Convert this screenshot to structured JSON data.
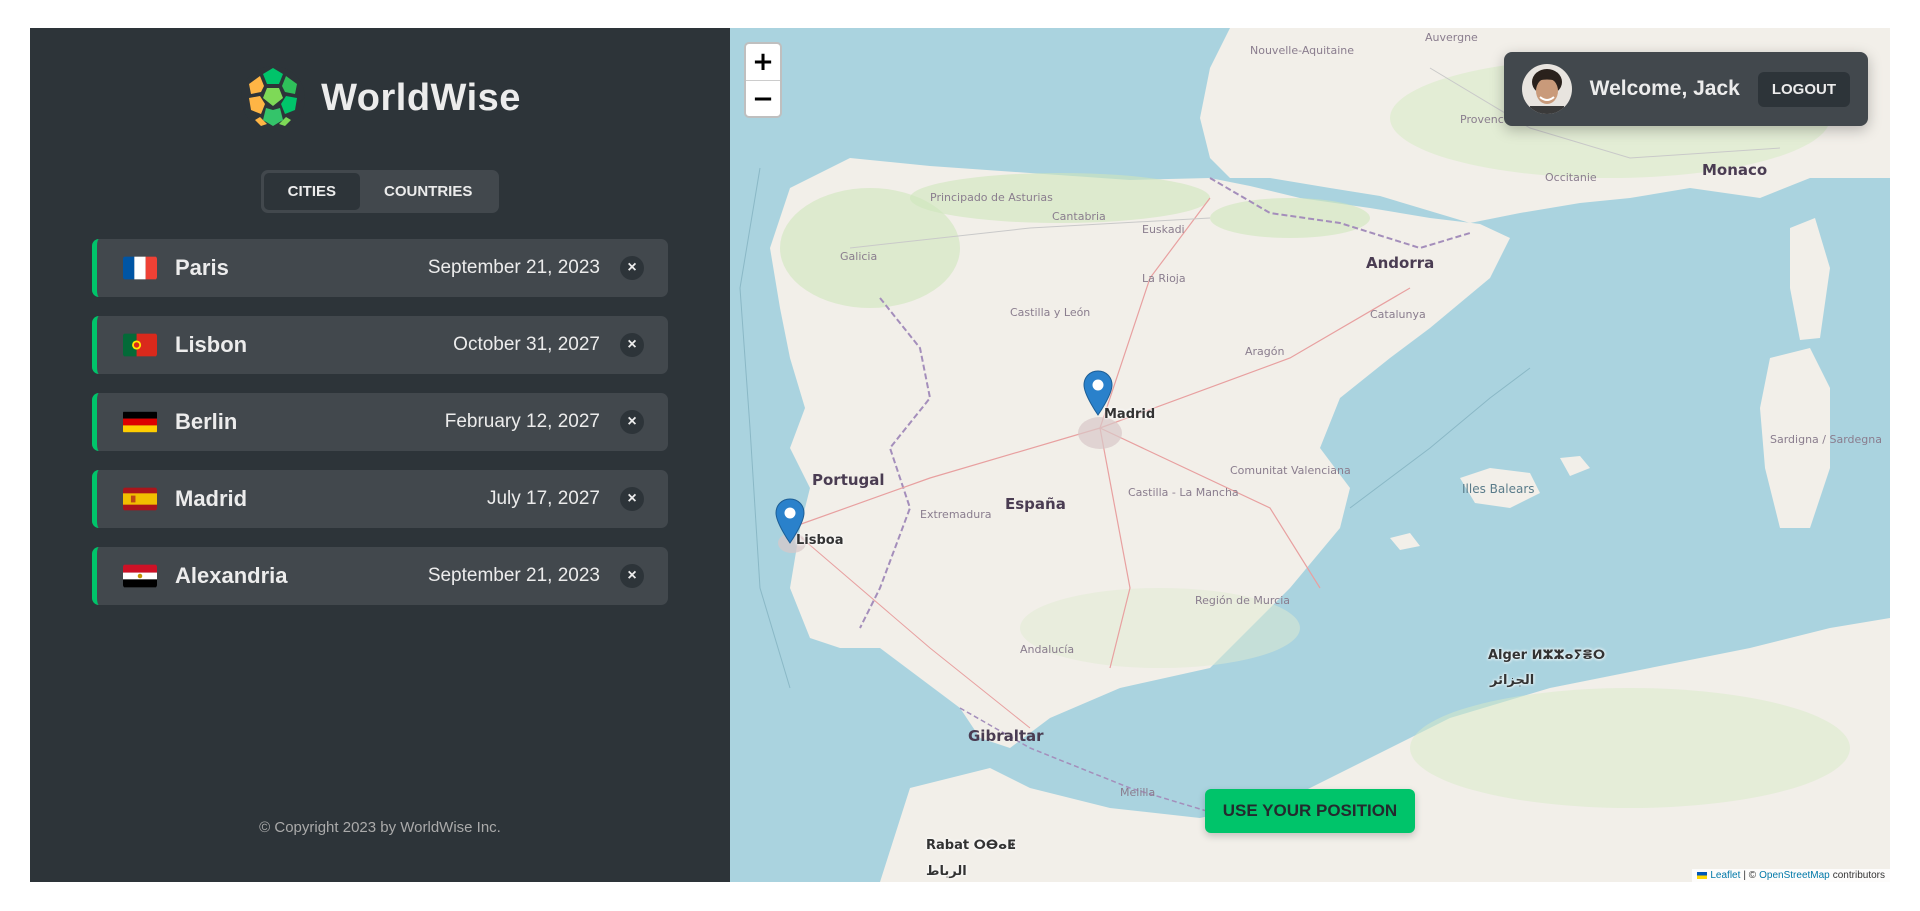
{
  "app": {
    "name": "WorldWise",
    "copyright": "© Copyright 2023 by WorldWise Inc."
  },
  "tabs": [
    {
      "label": "CITIES",
      "active": true
    },
    {
      "label": "COUNTRIES",
      "active": false
    }
  ],
  "cities": [
    {
      "name": "Paris",
      "date": "September 21, 2023",
      "flag": "fr"
    },
    {
      "name": "Lisbon",
      "date": "October 31, 2027",
      "flag": "pt"
    },
    {
      "name": "Berlin",
      "date": "February 12, 2027",
      "flag": "de"
    },
    {
      "name": "Madrid",
      "date": "July 17, 2027",
      "flag": "es"
    },
    {
      "name": "Alexandria",
      "date": "September 21, 2023",
      "flag": "eg"
    }
  ],
  "delete_symbol": "×",
  "map": {
    "zoom_in": "+",
    "zoom_out": "−",
    "user": {
      "welcome": "Welcome, Jack",
      "logout": "LOGOUT"
    },
    "use_position": "USE YOUR POSITION",
    "attribution": {
      "leaflet": "Leaflet",
      "separator": "| ©",
      "osm": "OpenStreetMap",
      "suffix": "contributors"
    },
    "labels": {
      "portugal": "Portugal",
      "espana": "España",
      "andorra": "Andorra",
      "monaco": "Monaco",
      "gibraltar": "Gibraltar",
      "madrid": "Madrid",
      "lisboa": "Lisboa",
      "alger": "Alger ⵍⵣⵣⴰⵢⴻⵔ",
      "aljazair": "الجزائر",
      "rabat": "Rabat ⵔⴱⴰⵟ",
      "rabat_ar": "الرباط",
      "galicia": "Galicia",
      "asturias": "Principado de Asturias",
      "cantabria": "Cantabria",
      "euskadi": "Euskadi",
      "larioja": "La Rioja",
      "castillaleon": "Castilla y León",
      "aragon": "Aragón",
      "catalunya": "Catalunya",
      "extremadura": "Extremadura",
      "castillamancha": "Castilla - La Mancha",
      "valenciana": "Comunitat Valenciana",
      "murcia": "Región de Murcia",
      "andalucia": "Andalucía",
      "illesbalears": "Illes Balears",
      "occitanie": "Occitanie",
      "aquitaine": "Nouvelle-Aquitaine",
      "provence": "Provence-Alpes-Côte d'Azur",
      "auvergne": "Auvergne",
      "sardegna": "Sardigna / Sardegna",
      "melilla": "Melilla"
    }
  }
}
